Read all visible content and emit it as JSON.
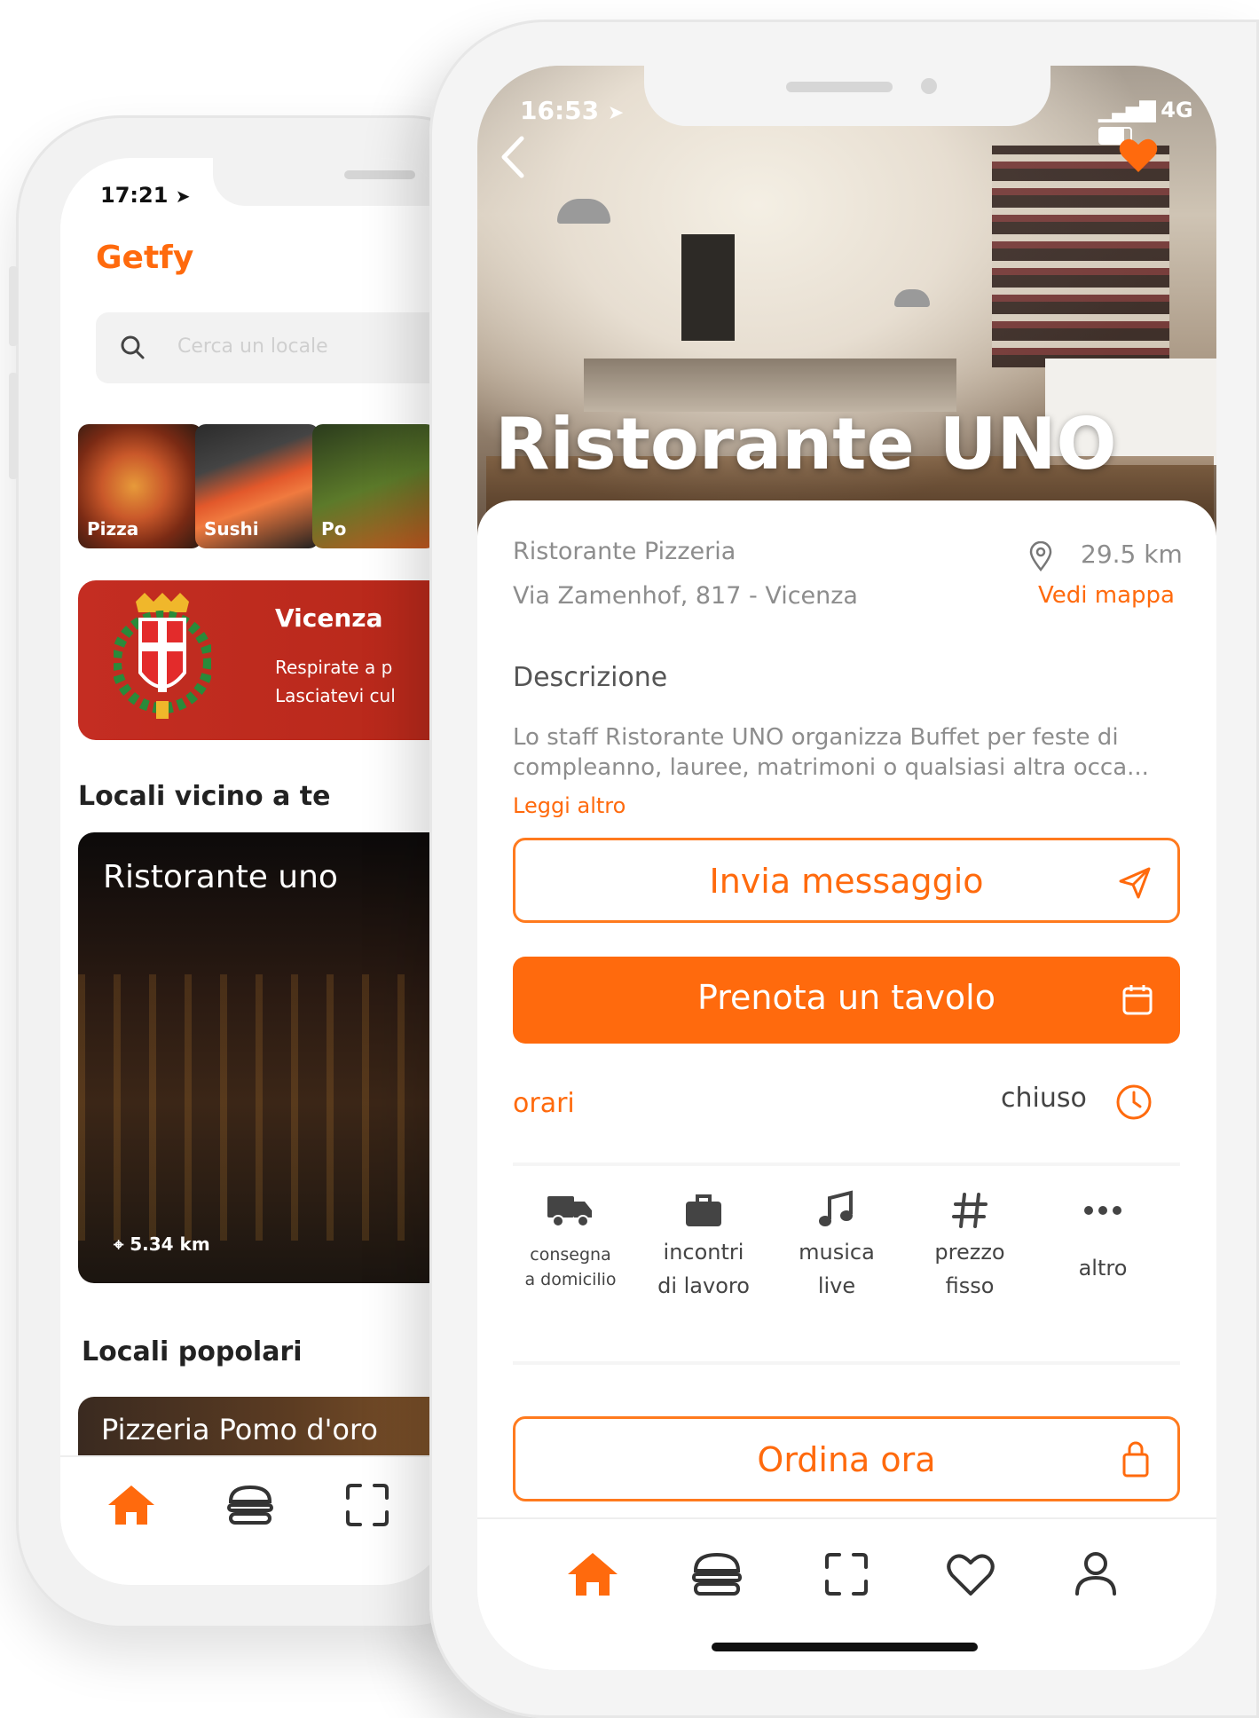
{
  "back_phone": {
    "status_time": "17:21",
    "brand": "Getfy",
    "search_placeholder": "Cerca un locale",
    "categories": [
      {
        "label": "Pizza"
      },
      {
        "label": "Sushi"
      },
      {
        "label": "Po"
      }
    ],
    "city": {
      "title": "Vicenza",
      "line1": "Respirate a p",
      "line2": "Lasciatevi cul"
    },
    "near_section_title": "Locali vicino a te",
    "near_card": {
      "title": "Ristorante uno",
      "distance": "5.34 km"
    },
    "popular_section_title": "Locali popolari",
    "popular_card": {
      "title": "Pizzeria Pomo d'oro"
    }
  },
  "front_phone": {
    "status_time": "16:53",
    "status_network": "4G",
    "restaurant_title": "Ristorante UNO",
    "type": "Ristorante Pizzeria",
    "address": "Via Zamenhof, 817 - Vicenza",
    "distance": "29.5 km",
    "map_link": "Vedi mappa",
    "description_title": "Descrizione",
    "description_line1": "Lo staff Ristorante UNO organizza Buffet per feste di",
    "description_line2": "compleanno, lauree, matrimoni o qualsiasi altra occa...",
    "read_more": "Leggi altro",
    "send_message": "Invia messaggio",
    "book_table": "Prenota un tavolo",
    "hours_label": "orari",
    "hours_status": "chiuso",
    "services": [
      {
        "icon": "delivery-truck-icon",
        "line1": "consegna",
        "line2": "a domicilio"
      },
      {
        "icon": "briefcase-icon",
        "line1": "incontri",
        "line2": "di lavoro"
      },
      {
        "icon": "music-note-icon",
        "line1": "musica",
        "line2": "live"
      },
      {
        "icon": "hashtag-icon",
        "line1": "prezzo",
        "line2": "fisso"
      },
      {
        "icon": "more-icon",
        "line1": "altro",
        "line2": ""
      }
    ],
    "order_now": "Ordina ora"
  },
  "colors": {
    "accent": "#ff6a0d",
    "city_card": "#c42d22",
    "text_dark": "#222222",
    "text_grey": "#8d8d8d"
  }
}
